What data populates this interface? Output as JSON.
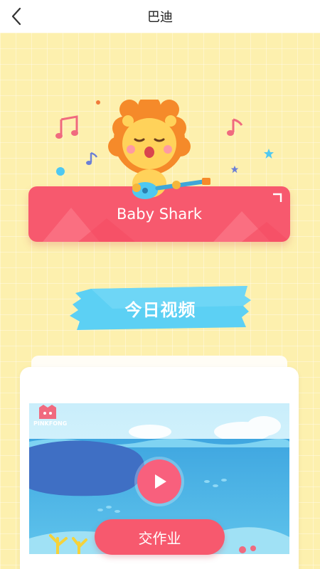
{
  "header": {
    "title": "巴迪",
    "back_icon": "chevron-left-icon"
  },
  "song_card": {
    "title": "Baby Shark",
    "mascot": "lion-guitar-icon"
  },
  "section_banner": {
    "label": "今日视频"
  },
  "video": {
    "brand_logo": "PINKFONG",
    "play_icon": "play-icon"
  },
  "actions": {
    "submit_label": "交作业"
  },
  "colors": {
    "background": "#fdf0ae",
    "accent_pink": "#f7596e",
    "banner_blue": "#4fc8f1",
    "header": "#ffffff"
  }
}
